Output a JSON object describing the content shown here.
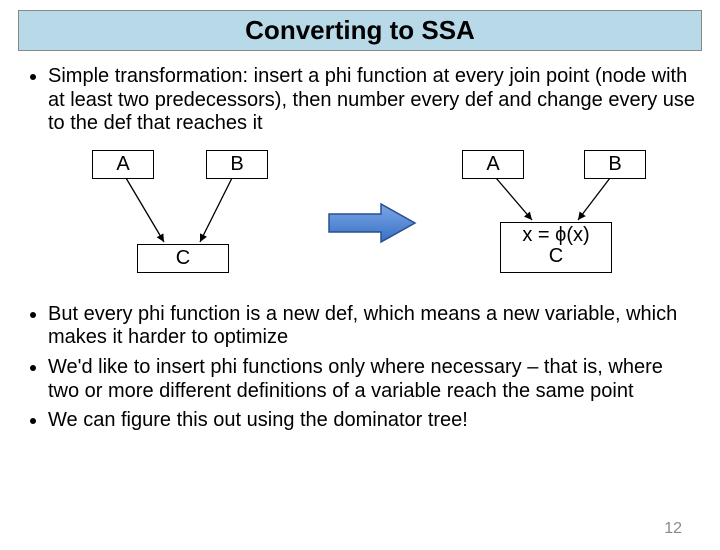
{
  "title": "Converting to SSA",
  "bullets": [
    "Simple transformation: insert a phi function at every join point (node with at least two predecessors), then number every def and change every use to the def that reaches it",
    "But every phi function is a new def, which means a new variable, which makes it harder to optimize",
    "We'd like to insert phi functions only where necessary – that is, where two or more different definitions of a variable reach the same point",
    "We can figure this out using the dominator tree!"
  ],
  "diagram": {
    "left": {
      "A": "A",
      "B": "B",
      "C": "C"
    },
    "right": {
      "A": "A",
      "B": "B",
      "phi": "x =  ϕ(x)",
      "C": "C"
    }
  },
  "page_number": "12"
}
